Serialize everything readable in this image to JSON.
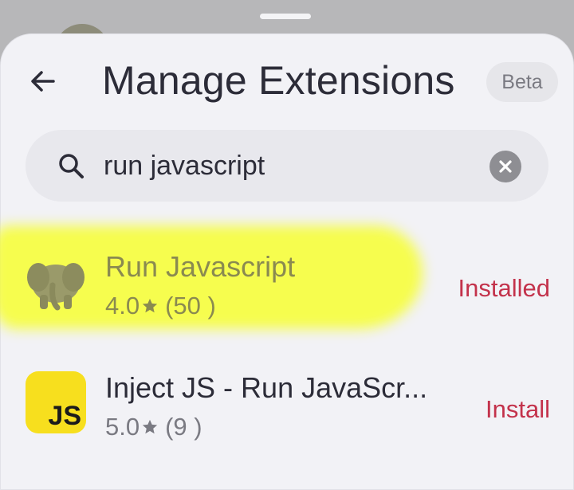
{
  "header": {
    "back_icon": "arrow-left-icon",
    "title": "Manage Extensions",
    "badge": "Beta"
  },
  "search": {
    "icon": "search-icon",
    "value": "run javascript",
    "clear_icon": "clear-icon"
  },
  "results": [
    {
      "name": "Run Javascript",
      "rating": "4.0",
      "reviews": "(50 )",
      "status": "Installed",
      "icon": "elephant-icon",
      "highlighted": true
    },
    {
      "name": "Inject JS - Run JavaScr...",
      "rating": "5.0",
      "reviews": "(9 )",
      "status": "Install",
      "icon": "js-icon",
      "icon_text": "JS"
    }
  ],
  "colors": {
    "accent": "#c3324b",
    "text": "#2c2c38",
    "muted": "#7a7a82",
    "highlight": "#f6ff28",
    "js_yellow": "#f7df1e"
  }
}
